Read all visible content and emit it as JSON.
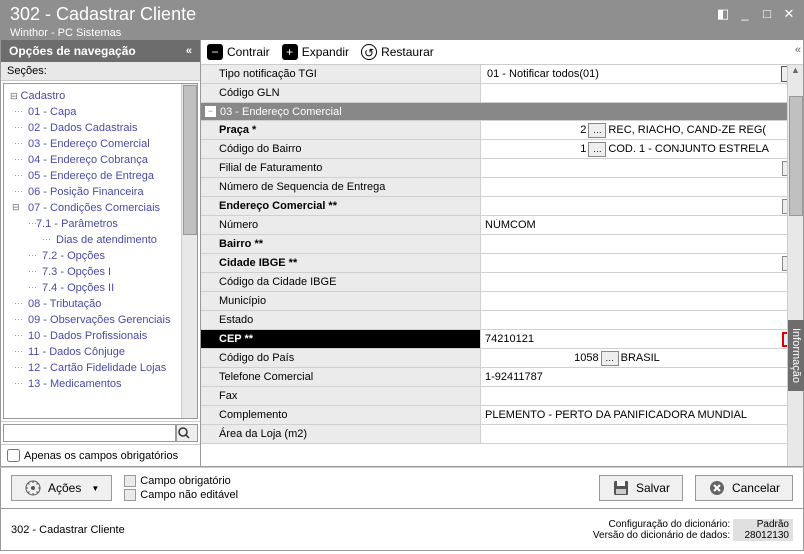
{
  "window": {
    "title": "302 - Cadastrar Cliente",
    "subtitle": "Winthor - PC Sistemas"
  },
  "nav": {
    "header": "Opções de navegação",
    "sections_label": "Seções:",
    "filter_label": "Apenas os campos obrigatórios",
    "tree": {
      "root": "Cadastro",
      "items": [
        "01 - Capa",
        "02 - Dados Cadastrais",
        "03 - Endereço Comercial",
        "04 - Endereço Cobrança",
        "05 - Endereço de Entrega",
        "06 - Posição Financeira"
      ],
      "exp07": "07 - Condições Comerciais",
      "sub71": "7.1 - Parâmetros",
      "sub71a": "Dias de atendimento",
      "sub72": "7.2 - Opções",
      "sub73": "7.3 - Opções I",
      "sub74": "7.4 - Opções II",
      "items2": [
        "08 - Tributação",
        "09 - Observações Gerenciais",
        "10 - Dados Profissionais",
        "11 - Dados Cônjuge",
        "12 - Cartão Fidelidade Lojas",
        "13 - Medicamentos"
      ]
    }
  },
  "toolbar": {
    "contrair": "Contrair",
    "expandir": "Expandir",
    "restaurar": "Restaurar"
  },
  "grid": {
    "rows_top": [
      {
        "label": "Tipo notificação TGI",
        "value": "01 - Notificar todos(01)",
        "type": "dropdown"
      },
      {
        "label": "Código GLN",
        "value": ""
      }
    ],
    "section": "03 - Endereço Comercial",
    "rows": [
      {
        "label": "Praça *",
        "bold": true,
        "num": "2",
        "txt": "REC, RIACHO, CAND-ZE REG(",
        "ellipsis": true
      },
      {
        "label": "Código do Bairro",
        "num": "1",
        "txt": "COD. 1 - CONJUNTO ESTRELA",
        "ellipsis": true
      },
      {
        "label": "Filial de Faturamento",
        "ellipsis": true
      },
      {
        "label": "Número de Sequencia de Entrega"
      },
      {
        "label": "Endereço Comercial **",
        "bold": true,
        "ellipsis": true
      },
      {
        "label": "Número",
        "value": "NÚMCOM"
      },
      {
        "label": "Bairro **",
        "bold": true
      },
      {
        "label": "Cidade IBGE **",
        "bold": true,
        "ellipsis": true
      },
      {
        "label": "Código da Cidade IBGE"
      },
      {
        "label": "Município"
      },
      {
        "label": "Estado"
      },
      {
        "label": "CEP **",
        "bold": true,
        "value": "74210121",
        "ellipsis": true,
        "selected": true
      },
      {
        "label": "Código do País",
        "num": "1058",
        "txt": "BRASIL",
        "ellipsis": true
      },
      {
        "label": "Telefone Comercial",
        "value": "1-92411787"
      },
      {
        "label": "Fax"
      },
      {
        "label": "Complemento",
        "value": "PLEMENTO - PERTO DA PANIFICADORA MUNDIAL"
      },
      {
        "label": "Área da Loja (m2)"
      }
    ]
  },
  "info_tab": "Informação",
  "buttons": {
    "acoes": "Ações",
    "salvar": "Salvar",
    "cancelar": "Cancelar",
    "legend1": "Campo obrigatório",
    "legend2": "Campo não editável"
  },
  "status": {
    "left": "302 - Cadastrar Cliente",
    "cfg_label": "Configuração do dicionário:",
    "cfg_val": "Padrão",
    "ver_label": "Versão do dicionário de dados:",
    "ver_val": "28012130"
  }
}
